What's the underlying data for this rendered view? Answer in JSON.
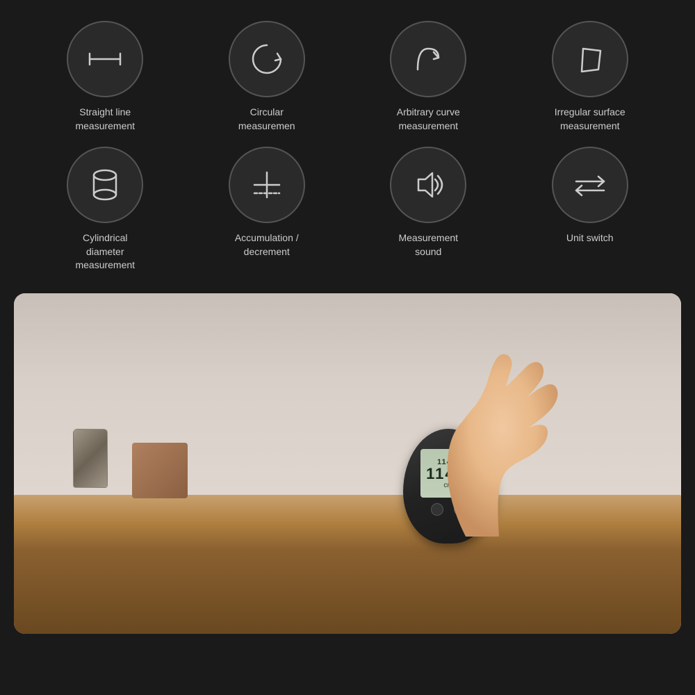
{
  "background_color": "#1a1a1a",
  "features": [
    {
      "id": "straight-line",
      "label": "Straight line\nmeasurement",
      "icon": "straight-line-icon"
    },
    {
      "id": "circular",
      "label": "Circular\nmeasuremen",
      "icon": "circular-icon"
    },
    {
      "id": "arbitrary-curve",
      "label": "Arbitrary curve\nmeasurement",
      "icon": "arbitrary-curve-icon"
    },
    {
      "id": "irregular-surface",
      "label": "Irregular surface\nmeasurement",
      "icon": "irregular-surface-icon"
    },
    {
      "id": "cylindrical",
      "label": "Cylindrical\ndiameter\nmeasurement",
      "icon": "cylindrical-icon"
    },
    {
      "id": "accumulation",
      "label": "Accumulation /\ndecrement",
      "icon": "accumulation-icon"
    },
    {
      "id": "measurement-sound",
      "label": "Measurement\nsound",
      "icon": "sound-icon"
    },
    {
      "id": "unit-switch",
      "label": "Unit switch",
      "icon": "unit-switch-icon"
    }
  ],
  "device": {
    "display_top": "114.2",
    "display_main": "114.2",
    "unit": "cm"
  }
}
